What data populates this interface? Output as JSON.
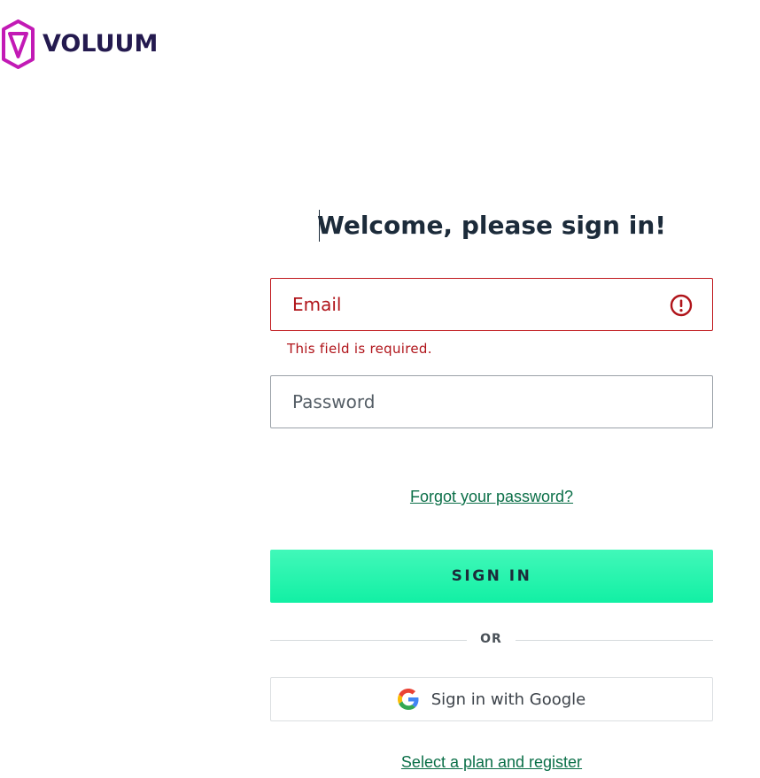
{
  "brand": {
    "name": "VOLUUM",
    "logo_icon": "voluum-logo-icon",
    "logo_color": "#c21ab5",
    "text_color": "#241a4f"
  },
  "login": {
    "title": "Welcome, please sign in!",
    "email": {
      "placeholder": "Email",
      "value": "",
      "error_message": "This field is required.",
      "error_icon": "exclamation-circle-icon",
      "error_color": "#c0181d"
    },
    "password": {
      "placeholder": "Password",
      "value": ""
    },
    "forgot_password_link": "Forgot your password?",
    "sign_in_button": "SIGN IN",
    "divider_text": "OR",
    "google_button": {
      "label": "Sign in with Google",
      "icon": "google-icon"
    },
    "register_link": "Select a plan and register",
    "accent_color": "#12f0a4",
    "link_color": "#0b6f48"
  }
}
